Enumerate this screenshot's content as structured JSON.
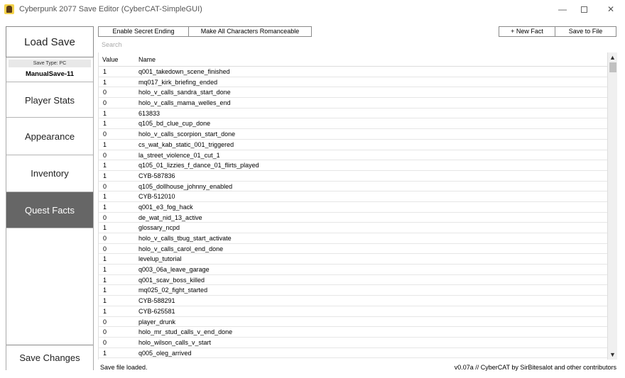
{
  "window": {
    "title": "Cyberpunk 2077 Save Editor (CyberCAT-SimpleGUI)",
    "controls": {
      "minimize": "—",
      "close": "✕"
    }
  },
  "sidebar": {
    "load_save": "Load Save",
    "save_type": "Save Type: PC",
    "save_name": "ManualSave-11",
    "items": [
      {
        "label": "Player Stats",
        "active": false
      },
      {
        "label": "Appearance",
        "active": false
      },
      {
        "label": "Inventory",
        "active": false
      },
      {
        "label": "Quest Facts",
        "active": true
      }
    ],
    "save_changes": "Save Changes"
  },
  "toolbar": {
    "enable_secret_ending": "Enable Secret Ending",
    "make_all_romanceable": "Make All Characters Romanceable",
    "new_fact": "+ New Fact",
    "save_to_file": "Save to File"
  },
  "search": {
    "placeholder": "Search",
    "value": ""
  },
  "table": {
    "columns": [
      "Value",
      "Name"
    ],
    "rows": [
      {
        "value": "1",
        "name": "q001_takedown_scene_finished"
      },
      {
        "value": "1",
        "name": "mq017_kirk_briefing_ended"
      },
      {
        "value": "0",
        "name": "holo_v_calls_sandra_start_done"
      },
      {
        "value": "0",
        "name": "holo_v_calls_mama_welles_end"
      },
      {
        "value": "1",
        "name": "613833"
      },
      {
        "value": "1",
        "name": "q105_bd_clue_cup_done"
      },
      {
        "value": "0",
        "name": "holo_v_calls_scorpion_start_done"
      },
      {
        "value": "1",
        "name": "cs_wat_kab_static_001_triggered"
      },
      {
        "value": "0",
        "name": "la_street_violence_01_cut_1"
      },
      {
        "value": "1",
        "name": "q105_01_lizzies_f_dance_01_flirts_played"
      },
      {
        "value": "1",
        "name": "CYB-587836"
      },
      {
        "value": "0",
        "name": "q105_dollhouse_johnny_enabled"
      },
      {
        "value": "1",
        "name": "CYB-512010"
      },
      {
        "value": "1",
        "name": "q001_e3_fog_hack"
      },
      {
        "value": "0",
        "name": "de_wat_nid_13_active"
      },
      {
        "value": "1",
        "name": "glossary_ncpd"
      },
      {
        "value": "0",
        "name": "holo_v_calls_tbug_start_activate"
      },
      {
        "value": "0",
        "name": "holo_v_calls_carol_end_done"
      },
      {
        "value": "1",
        "name": "levelup_tutorial"
      },
      {
        "value": "1",
        "name": "q003_06a_leave_garage"
      },
      {
        "value": "1",
        "name": "q001_scav_boss_killed"
      },
      {
        "value": "1",
        "name": "mq025_02_fight_started"
      },
      {
        "value": "1",
        "name": "CYB-588291"
      },
      {
        "value": "1",
        "name": "CYB-625581"
      },
      {
        "value": "0",
        "name": "player_drunk"
      },
      {
        "value": "0",
        "name": "holo_mr_stud_calls_v_end_done"
      },
      {
        "value": "0",
        "name": "holo_wilson_calls_v_start"
      },
      {
        "value": "1",
        "name": "q005_oleg_arrived"
      }
    ]
  },
  "scrollbar": {
    "up": "▲",
    "down": "▼"
  },
  "status": {
    "message": "Save file loaded.",
    "version": "v0.07a // CyberCAT by SirBitesalot and other contributors"
  }
}
